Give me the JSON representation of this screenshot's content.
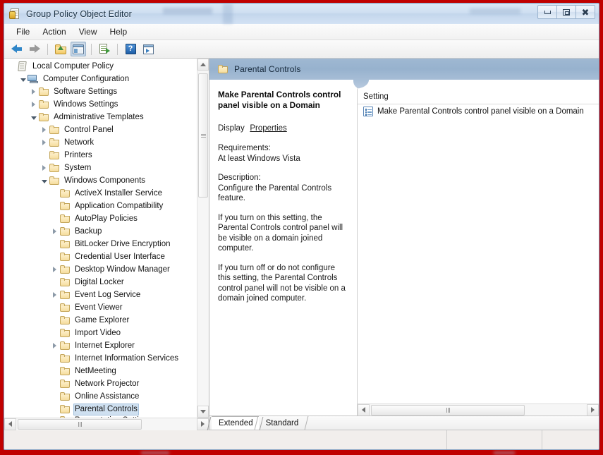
{
  "window": {
    "title": "Group Policy Object Editor",
    "icon": "group-policy-icon",
    "controls": {
      "minimize": "Minimize",
      "maximize": "Restore",
      "close": "Close"
    }
  },
  "menubar": {
    "items": [
      {
        "label": "File"
      },
      {
        "label": "Action"
      },
      {
        "label": "View"
      },
      {
        "label": "Help"
      }
    ]
  },
  "toolbar": {
    "buttons": [
      {
        "name": "back-arrow-icon",
        "tooltip": "Back"
      },
      {
        "name": "forward-arrow-icon",
        "tooltip": "Forward"
      },
      {
        "name": "folder-up-icon",
        "tooltip": "Up One Level"
      },
      {
        "name": "show-console-tree-icon",
        "tooltip": "Show/Hide Console Tree",
        "pressed": true
      },
      {
        "name": "export-list-icon",
        "tooltip": "Export List"
      },
      {
        "name": "help-icon",
        "tooltip": "Help"
      },
      {
        "name": "show-action-pane-icon",
        "tooltip": "Show/Hide Action Pane"
      }
    ]
  },
  "tree": {
    "nodes": [
      {
        "label": "Local Computer Policy",
        "indent": 0,
        "expander": "none",
        "icon": "policy-icon",
        "selected": false
      },
      {
        "label": "Computer Configuration",
        "indent": 1,
        "expander": "expanded",
        "icon": "computer-icon",
        "selected": false
      },
      {
        "label": "Software Settings",
        "indent": 2,
        "expander": "collapsed",
        "icon": "folder-icon",
        "selected": false
      },
      {
        "label": "Windows Settings",
        "indent": 2,
        "expander": "collapsed",
        "icon": "folder-icon",
        "selected": false
      },
      {
        "label": "Administrative Templates",
        "indent": 2,
        "expander": "expanded",
        "icon": "folder-icon",
        "selected": false
      },
      {
        "label": "Control Panel",
        "indent": 3,
        "expander": "collapsed",
        "icon": "folder-icon",
        "selected": false
      },
      {
        "label": "Network",
        "indent": 3,
        "expander": "collapsed",
        "icon": "folder-icon",
        "selected": false
      },
      {
        "label": "Printers",
        "indent": 3,
        "expander": "none",
        "icon": "folder-icon",
        "selected": false
      },
      {
        "label": "System",
        "indent": 3,
        "expander": "collapsed",
        "icon": "folder-icon",
        "selected": false
      },
      {
        "label": "Windows Components",
        "indent": 3,
        "expander": "expanded",
        "icon": "folder-icon",
        "selected": false
      },
      {
        "label": "ActiveX Installer Service",
        "indent": 4,
        "expander": "none",
        "icon": "folder-icon",
        "selected": false
      },
      {
        "label": "Application Compatibility",
        "indent": 4,
        "expander": "none",
        "icon": "folder-icon",
        "selected": false
      },
      {
        "label": "AutoPlay Policies",
        "indent": 4,
        "expander": "none",
        "icon": "folder-icon",
        "selected": false
      },
      {
        "label": "Backup",
        "indent": 4,
        "expander": "collapsed",
        "icon": "folder-icon",
        "selected": false
      },
      {
        "label": "BitLocker Drive Encryption",
        "indent": 4,
        "expander": "none",
        "icon": "folder-icon",
        "selected": false
      },
      {
        "label": "Credential User Interface",
        "indent": 4,
        "expander": "none",
        "icon": "folder-icon",
        "selected": false
      },
      {
        "label": "Desktop Window Manager",
        "indent": 4,
        "expander": "collapsed",
        "icon": "folder-icon",
        "selected": false
      },
      {
        "label": "Digital Locker",
        "indent": 4,
        "expander": "none",
        "icon": "folder-icon",
        "selected": false
      },
      {
        "label": "Event Log Service",
        "indent": 4,
        "expander": "collapsed",
        "icon": "folder-icon",
        "selected": false
      },
      {
        "label": "Event Viewer",
        "indent": 4,
        "expander": "none",
        "icon": "folder-icon",
        "selected": false
      },
      {
        "label": "Game Explorer",
        "indent": 4,
        "expander": "none",
        "icon": "folder-icon",
        "selected": false
      },
      {
        "label": "Import Video",
        "indent": 4,
        "expander": "none",
        "icon": "folder-icon",
        "selected": false
      },
      {
        "label": "Internet Explorer",
        "indent": 4,
        "expander": "collapsed",
        "icon": "folder-icon",
        "selected": false
      },
      {
        "label": "Internet Information Services",
        "indent": 4,
        "expander": "none",
        "icon": "folder-icon",
        "selected": false
      },
      {
        "label": "NetMeeting",
        "indent": 4,
        "expander": "none",
        "icon": "folder-icon",
        "selected": false
      },
      {
        "label": "Network Projector",
        "indent": 4,
        "expander": "none",
        "icon": "folder-icon",
        "selected": false
      },
      {
        "label": "Online Assistance",
        "indent": 4,
        "expander": "none",
        "icon": "folder-icon",
        "selected": false
      },
      {
        "label": "Parental Controls",
        "indent": 4,
        "expander": "none",
        "icon": "folder-icon",
        "selected": true
      },
      {
        "label": "Presentation Settings",
        "indent": 4,
        "expander": "none",
        "icon": "folder-icon",
        "selected": false,
        "clipped": true
      }
    ]
  },
  "pane_header": {
    "title": "Parental Controls",
    "icon": "folder-icon"
  },
  "description": {
    "title": "Make Parental Controls control panel visible on a Domain",
    "display_label": "Display",
    "display_link": "Properties",
    "requirements_label": "Requirements:",
    "requirements_value": "At least Windows Vista",
    "description_label": "Description:",
    "description_value": "Configure the Parental Controls feature.",
    "paragraph_on": "If you turn on this setting, the Parental Controls control panel will be visible on a domain joined computer.",
    "paragraph_off": "If you turn off or do not configure this setting, the Parental Controls control panel will not be visible on a domain joined computer."
  },
  "settings_list": {
    "column_header": "Setting",
    "rows": [
      {
        "label": "Make Parental Controls control panel visible on a Domain",
        "icon": "policy-setting-icon"
      }
    ]
  },
  "view_tabs": {
    "items": [
      {
        "label": "Extended",
        "active": true
      },
      {
        "label": "Standard",
        "active": false
      }
    ]
  },
  "statusbar": {
    "main_text": "",
    "segment_a": "",
    "segment_b": ""
  },
  "colors": {
    "capture_border": "#c00000",
    "titlebar": "#cfdff1",
    "pane_header": "#9fb8d2",
    "selection": "#cfe0f0",
    "link": "#1c5fb0"
  }
}
